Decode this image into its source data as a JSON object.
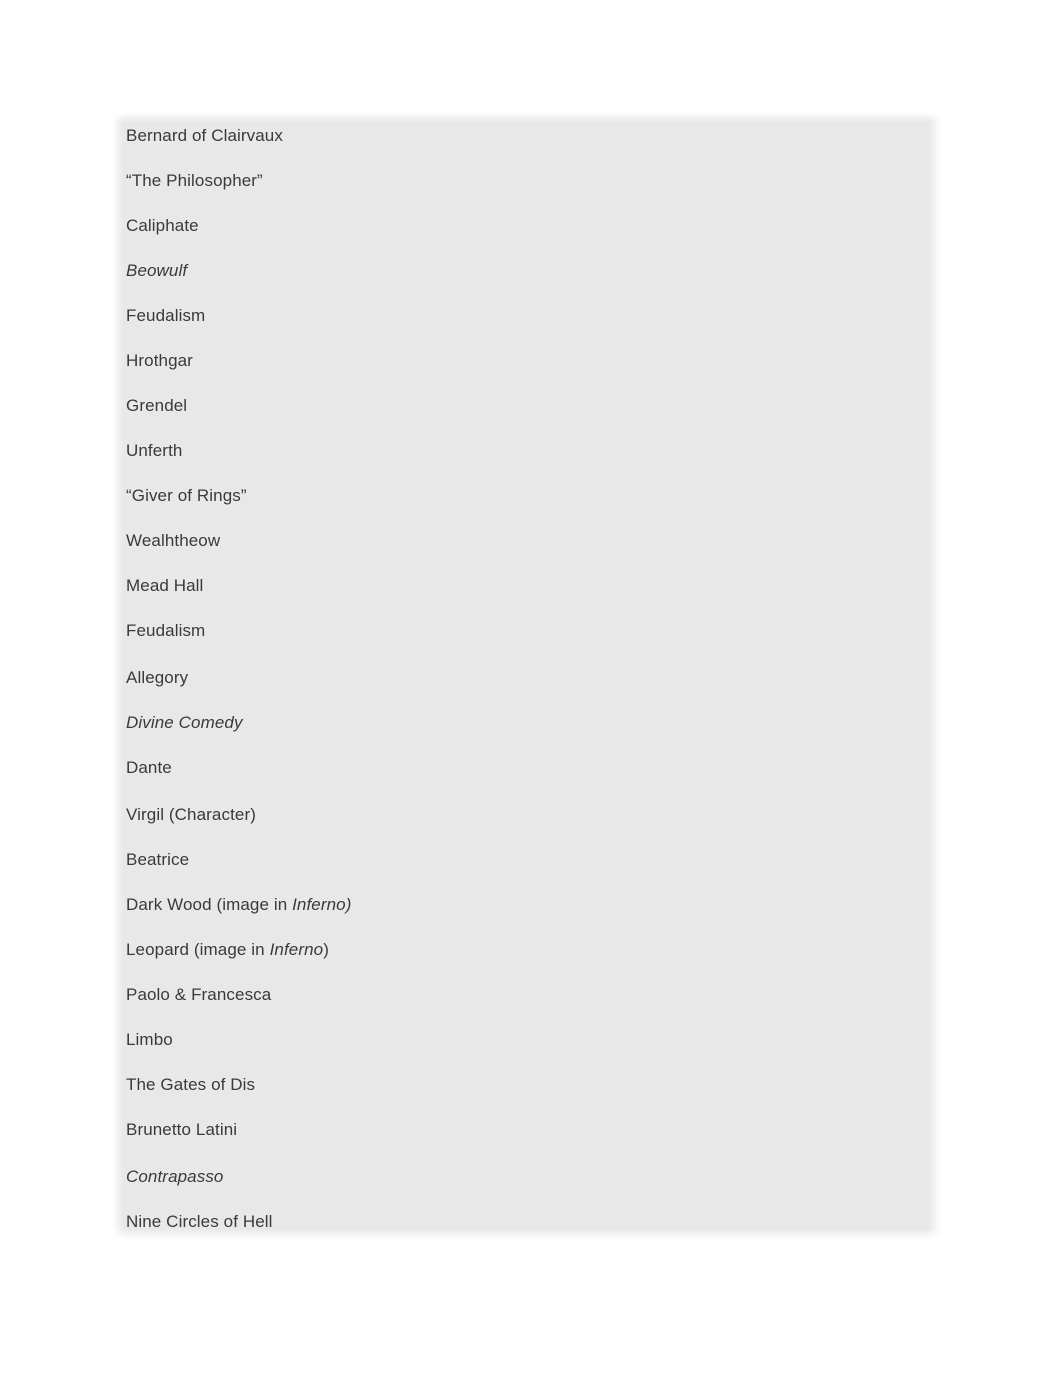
{
  "document": {
    "background_color": "#e8e8e8",
    "text_color": "#3a3a3a",
    "lines": [
      {
        "text": "Bernard of Clairvaux",
        "style": "normal"
      },
      {
        "text": "“The Philosopher”",
        "style": "normal"
      },
      {
        "text": "Caliphate",
        "style": "normal"
      },
      {
        "text": "Beowulf",
        "style": "italic"
      },
      {
        "text": "Feudalism",
        "style": "normal"
      },
      {
        "text": "Hrothgar",
        "style": "normal"
      },
      {
        "text": "Grendel",
        "style": "normal"
      },
      {
        "text": "Unferth",
        "style": "normal"
      },
      {
        "text": "“Giver of Rings”",
        "style": "normal"
      },
      {
        "text": "Wealhtheow",
        "style": "normal"
      },
      {
        "text": "Mead Hall",
        "style": "normal"
      },
      {
        "text": "Feudalism",
        "style": "normal"
      },
      {
        "text": "Allegory",
        "style": "normal",
        "extra_gap": true
      },
      {
        "text": "Divine Comedy",
        "style": "italic"
      },
      {
        "text": "Dante",
        "style": "normal"
      },
      {
        "text": "Virgil (Character)",
        "style": "normal",
        "extra_gap": true
      },
      {
        "text": "Beatrice",
        "style": "normal"
      },
      {
        "text": "Dark Wood (image in Inferno)",
        "style": "mixed",
        "runs": [
          {
            "text": "Dark Wood (image in ",
            "italic": false
          },
          {
            "text": "Inferno)",
            "italic": true
          }
        ]
      },
      {
        "text": "Leopard (image in Inferno)",
        "style": "mixed",
        "runs": [
          {
            "text": "Leopard (image in ",
            "italic": false
          },
          {
            "text": "Inferno",
            "italic": true
          },
          {
            "text": ")",
            "italic": false
          }
        ]
      },
      {
        "text": "Paolo & Francesca",
        "style": "normal"
      },
      {
        "text": "Limbo",
        "style": "normal"
      },
      {
        "text": "The Gates of Dis",
        "style": "normal"
      },
      {
        "text": "Brunetto Latini",
        "style": "normal"
      },
      {
        "text": "Contrapasso",
        "style": "italic",
        "extra_gap": true
      },
      {
        "text": "Nine Circles of Hell",
        "style": "normal"
      }
    ]
  }
}
